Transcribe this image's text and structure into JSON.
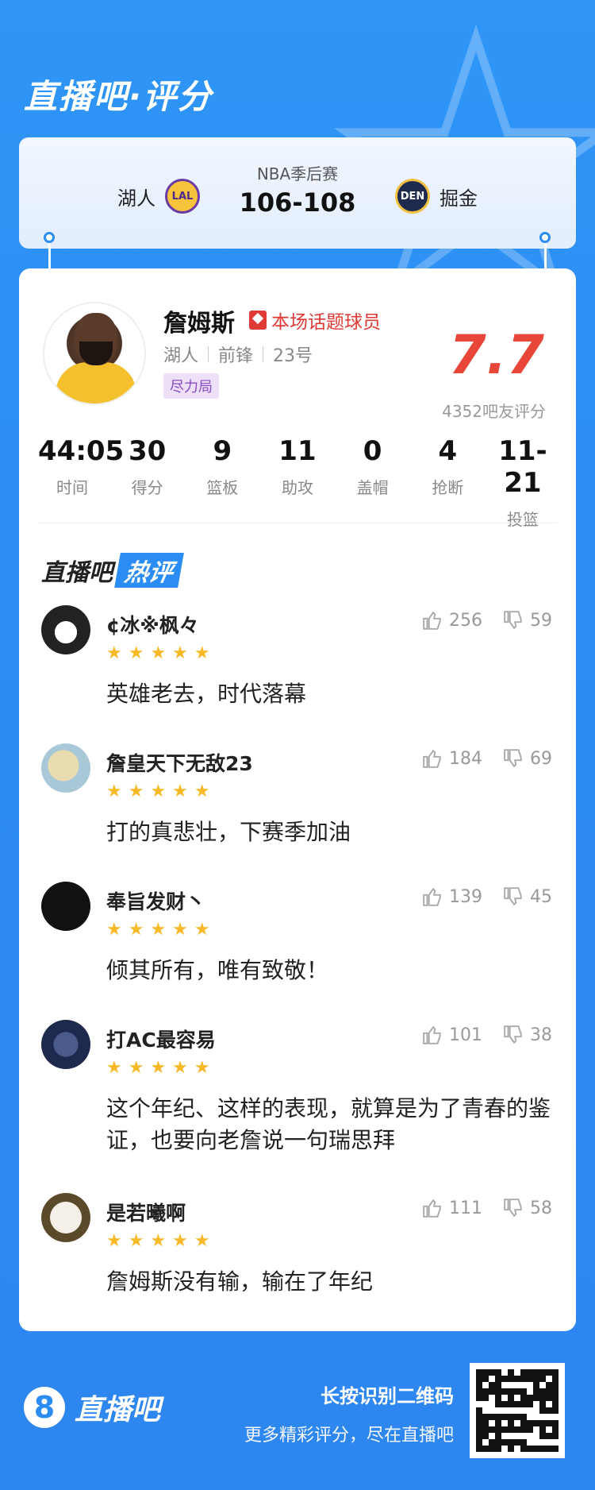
{
  "header": {
    "title": "直播吧·评分"
  },
  "match": {
    "type": "NBA季后赛",
    "score": "106-108",
    "home": {
      "name": "湖人",
      "logo": "LAL"
    },
    "away": {
      "name": "掘金",
      "logo": "DEN"
    }
  },
  "player": {
    "name": "詹姆斯",
    "topic_badge": "本场话题球员",
    "team": "湖人",
    "position": "前锋",
    "number": "23号",
    "tag": "尽力局",
    "rating": "7.7",
    "rating_count": "4352吧友评分"
  },
  "stats": [
    {
      "value": "44:05",
      "label": "时间"
    },
    {
      "value": "30",
      "label": "得分"
    },
    {
      "value": "9",
      "label": "篮板"
    },
    {
      "value": "11",
      "label": "助攻"
    },
    {
      "value": "0",
      "label": "盖帽"
    },
    {
      "value": "4",
      "label": "抢断"
    },
    {
      "value": "11-21",
      "label": "投篮"
    }
  ],
  "hot_comments": {
    "title_prefix": "直播吧",
    "title_badge": "热评",
    "items": [
      {
        "user": "¢冰※枫々",
        "stars": "★★★★★",
        "likes": "256",
        "dislikes": "59",
        "text": "英雄老去，时代落幕"
      },
      {
        "user": "詹皇天下无敌23",
        "stars": "★★★★★",
        "likes": "184",
        "dislikes": "69",
        "text": "打的真悲壮，下赛季加油"
      },
      {
        "user": "奉旨发财丶",
        "stars": "★★★★★",
        "likes": "139",
        "dislikes": "45",
        "text": "倾其所有，唯有致敬！"
      },
      {
        "user": "打AC最容易",
        "stars": "★★★★★",
        "likes": "101",
        "dislikes": "38",
        "text": "这个年纪、这样的表现，就算是为了青春的鉴证，也要向老詹说一句瑞思拜"
      },
      {
        "user": "是若曦啊",
        "stars": "★★★★★",
        "likes": "111",
        "dislikes": "58",
        "text": "詹姆斯没有输，输在了年纪"
      }
    ]
  },
  "footer": {
    "brand": "直播吧",
    "logo_char": "8",
    "line1": "长按识别二维码",
    "line2": "更多精彩评分，尽在直播吧"
  },
  "colors": {
    "primary": "#2b8cf3",
    "rating": "#e9463a",
    "star": "#f7b928",
    "topic": "#e03a36"
  }
}
